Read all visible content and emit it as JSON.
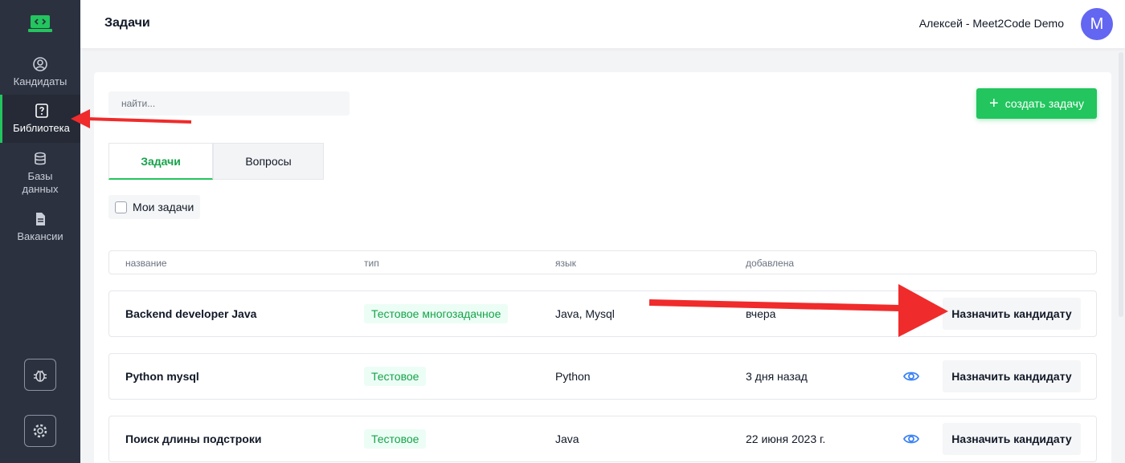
{
  "sidebar": {
    "logo_icon": "code-laptop-icon",
    "items": [
      {
        "label": "Кандидаты",
        "icon": "user-circle-icon"
      },
      {
        "label": "Библиотека",
        "icon": "question-book-icon",
        "active": true
      },
      {
        "label": "Базы данных",
        "icon": "database-icon"
      },
      {
        "label": "Вакансии",
        "icon": "document-icon"
      }
    ],
    "bottom_buttons": [
      "bug-icon",
      "gear-icon"
    ]
  },
  "header": {
    "title": "Задачи",
    "user_name": "Алексей - Meet2Code Demo",
    "avatar_letter": "M"
  },
  "main": {
    "search_placeholder": "найти...",
    "create_button_label": "создать задачу",
    "tabs": [
      {
        "label": "Задачи",
        "active": true
      },
      {
        "label": "Вопросы",
        "active": false
      }
    ],
    "my_tasks_label": "Мои задачи",
    "table": {
      "columns": [
        "название",
        "тип",
        "язык",
        "добавлена"
      ],
      "rows": [
        {
          "name": "Backend developer Java",
          "type": "Тестовое многозадачное",
          "language": "Java, Mysql",
          "added": "вчера",
          "show_eye": false,
          "action": "Назначить кандидату"
        },
        {
          "name": "Python mysql",
          "type": "Тестовое",
          "language": "Python",
          "added": "3 дня назад",
          "show_eye": true,
          "action": "Назначить кандидату"
        },
        {
          "name": "Поиск длины подстроки",
          "type": "Тестовое",
          "language": "Java",
          "added": "22 июня 2023 г.",
          "show_eye": true,
          "action": "Назначить кандидату"
        }
      ]
    }
  },
  "colors": {
    "accent": "#22c55e",
    "sidebar_bg": "#2c3140",
    "avatar_bg": "#6366f1",
    "annotation_arrow": "#f02b2b"
  }
}
